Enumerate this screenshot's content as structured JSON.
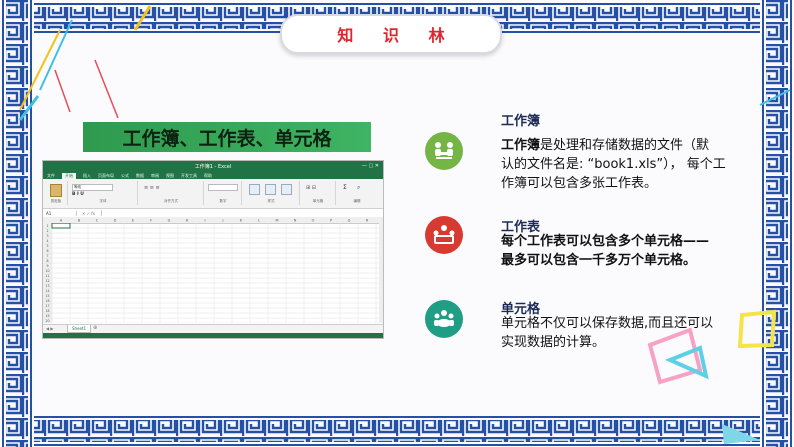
{
  "title": "知 识 林",
  "banner": "工作簿、工作表、单元格",
  "excel": {
    "window_title": "工作簿1 - Excel",
    "tabs": [
      "文件",
      "开始",
      "插入",
      "页面布局",
      "公式",
      "数据",
      "审阅",
      "视图",
      "开发工具",
      "帮助"
    ],
    "ribbon_groups": [
      "剪贴板",
      "字体",
      "对齐方式",
      "数字",
      "样式",
      "单元格",
      "编辑"
    ],
    "font_name": "等线",
    "name_box": "A1",
    "columns": [
      "A",
      "B",
      "C",
      "D",
      "E",
      "F",
      "G",
      "H",
      "I",
      "J",
      "K",
      "L",
      "M",
      "N",
      "O",
      "P",
      "Q",
      "R"
    ],
    "rows": [
      "1",
      "2",
      "3",
      "4",
      "5",
      "6",
      "7",
      "8",
      "9",
      "10",
      "11",
      "12",
      "13",
      "14",
      "15",
      "16",
      "17",
      "18",
      "19",
      "20"
    ],
    "sheet_tab": "Sheet1"
  },
  "items": [
    {
      "icon": "people-icon",
      "color": "#74b545",
      "heading": "工作簿",
      "lead": "工作簿",
      "line1": "是处理和存储数据的文件（默",
      "line2": "认的文件名是: “book1.xls”）， 每个工",
      "line3": "作簿可以包含多张工作表。"
    },
    {
      "icon": "meeting-icon",
      "color": "#d63a30",
      "heading": "工作表",
      "line1": "每个工作表可以包含多个单元格——",
      "line2": "最多可以包含一千多万个单元格。"
    },
    {
      "icon": "team-icon",
      "color": "#1f9e85",
      "heading": "单元格",
      "line1": "单元格不仅可以保存数据,而且还可以",
      "line2": "实现数据的计算。"
    }
  ]
}
